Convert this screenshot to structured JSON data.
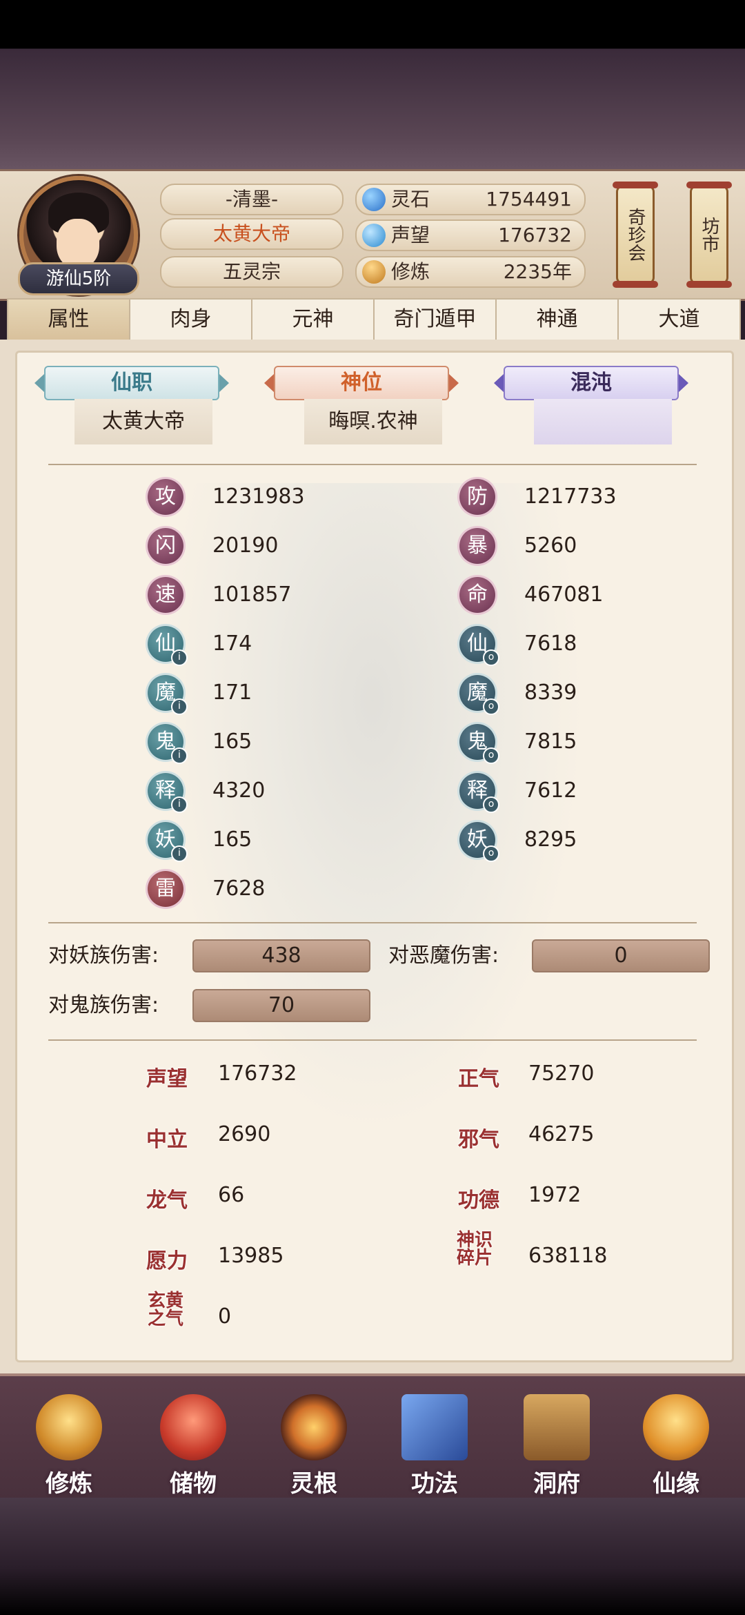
{
  "player": {
    "rank": "游仙5阶",
    "name": "-清墨-",
    "title": "太黄大帝",
    "sect": "五灵宗"
  },
  "resources": [
    {
      "label": "灵石",
      "value": "1754491",
      "icon": "spirit-stone-icon",
      "color": "#3a8ad8"
    },
    {
      "label": "声望",
      "value": "176732",
      "icon": "prestige-icon",
      "color": "#3aa0e0"
    },
    {
      "label": "修炼",
      "value": "2235年",
      "icon": "meditation-icon",
      "color": "#d89a3a"
    }
  ],
  "side_buttons": {
    "rare": "奇珍会",
    "market": "坊市"
  },
  "tabs": [
    "属性",
    "肉身",
    "元神",
    "奇门遁甲",
    "神通",
    "大道"
  ],
  "active_tab": "属性",
  "positions": {
    "xianzhi_label": "仙职",
    "xianzhi_value": "太黄大帝",
    "shenwei_label": "神位",
    "shenwei_value": "晦暝.农神",
    "hundun_label": "混沌",
    "hundun_value": ""
  },
  "stats_left": [
    {
      "icon": "攻",
      "value": "1231983"
    },
    {
      "icon": "闪",
      "value": "20190"
    },
    {
      "icon": "速",
      "value": "101857"
    },
    {
      "icon": "仙",
      "value": "174"
    },
    {
      "icon": "魔",
      "value": "171"
    },
    {
      "icon": "鬼",
      "value": "165"
    },
    {
      "icon": "释",
      "value": "4320"
    },
    {
      "icon": "妖",
      "value": "165"
    },
    {
      "icon": "雷",
      "value": "7628"
    }
  ],
  "stats_right": [
    {
      "icon": "防",
      "value": "1217733"
    },
    {
      "icon": "暴",
      "value": "5260"
    },
    {
      "icon": "命",
      "value": "467081"
    },
    {
      "icon": "仙",
      "value": "7618"
    },
    {
      "icon": "魔",
      "value": "8339"
    },
    {
      "icon": "鬼",
      "value": "7815"
    },
    {
      "icon": "释",
      "value": "7612"
    },
    {
      "icon": "妖",
      "value": "8295"
    }
  ],
  "damage": {
    "yao_label": "对妖族伤害:",
    "yao_value": "438",
    "emo_label": "对恶魔伤害:",
    "emo_value": "0",
    "gui_label": "对鬼族伤害:",
    "gui_value": "70"
  },
  "misc_left": [
    {
      "label": "声望",
      "value": "176732"
    },
    {
      "label": "中立",
      "value": "2690"
    },
    {
      "label": "龙气",
      "value": "66"
    },
    {
      "label": "愿力",
      "value": "13985"
    },
    {
      "label": "玄黄之气",
      "value": "0"
    }
  ],
  "misc_right": [
    {
      "label": "正气",
      "value": "75270"
    },
    {
      "label": "邪气",
      "value": "46275"
    },
    {
      "label": "功德",
      "value": "1972"
    },
    {
      "label": "神识碎片",
      "value": "638118"
    }
  ],
  "nav": [
    {
      "label": "修炼",
      "icon": "cultivate-icon",
      "color": "#e0a040"
    },
    {
      "label": "储物",
      "icon": "storage-bag-icon",
      "color": "#d04838"
    },
    {
      "label": "灵根",
      "icon": "spirit-root-icon",
      "color": "#c88a30"
    },
    {
      "label": "功法",
      "icon": "technique-book-icon",
      "color": "#4a78c8"
    },
    {
      "label": "洞府",
      "icon": "cave-abode-icon",
      "color": "#b88a50"
    },
    {
      "label": "仙缘",
      "icon": "immortal-fate-icon",
      "color": "#e8a838"
    }
  ]
}
